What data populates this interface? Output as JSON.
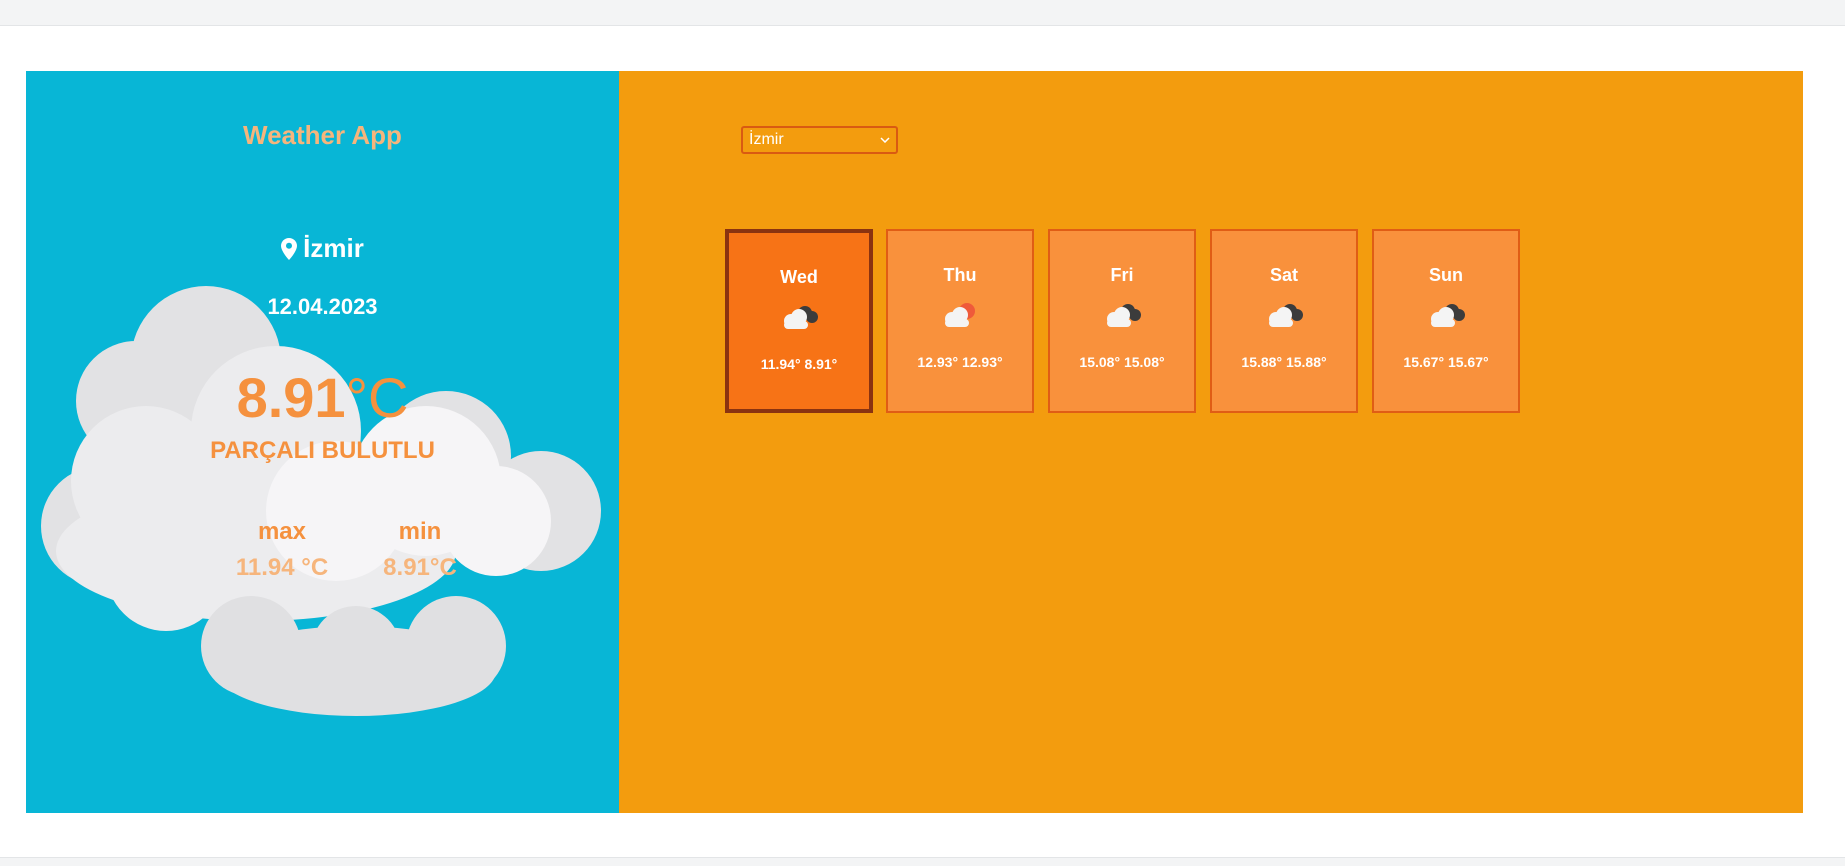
{
  "app": {
    "title": "Weather App",
    "city": "İzmir",
    "date": "12.04.2023",
    "temp_value": "8.91",
    "temp_unit": "°C",
    "description": "PARÇALI BULUTLU",
    "max_label": "max",
    "max_value": "11.94 °C",
    "min_label": "min",
    "min_value": "8.91°C"
  },
  "selector": {
    "value": "İzmir"
  },
  "days": [
    {
      "name": "Wed",
      "temps": "11.94°  8.91°",
      "icon": "partly-cloudy-night-icon"
    },
    {
      "name": "Thu",
      "temps": "12.93° 12.93°",
      "icon": "cloudy-sun-icon"
    },
    {
      "name": "Fri",
      "temps": "15.08° 15.08°",
      "icon": "partly-cloudy-night-icon"
    },
    {
      "name": "Sat",
      "temps": "15.88° 15.88°",
      "icon": "partly-cloudy-night-icon"
    },
    {
      "name": "Sun",
      "temps": "15.67° 15.67°",
      "icon": "partly-cloudy-night-icon"
    }
  ],
  "colors": {
    "left_panel": "#08b6d6",
    "right_panel": "#f39c0e",
    "accent_orange": "#f5913e",
    "active_card": "#f77316"
  }
}
